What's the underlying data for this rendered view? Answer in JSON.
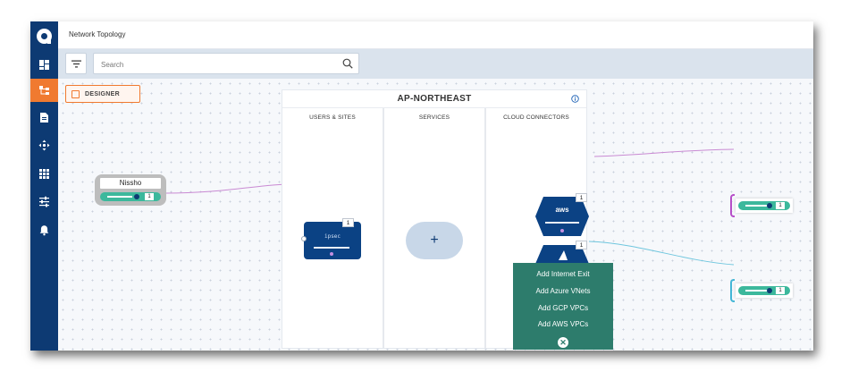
{
  "header": {
    "title": "Network Topology"
  },
  "toolbar": {
    "search_placeholder": "Search"
  },
  "sidebar": {
    "items": [
      {
        "icon": "dashboard-icon"
      },
      {
        "icon": "topology-icon",
        "active": true
      },
      {
        "icon": "document-icon"
      },
      {
        "icon": "move-icon"
      },
      {
        "icon": "apps-grid-icon"
      },
      {
        "icon": "sliders-icon"
      },
      {
        "icon": "bell-icon"
      }
    ]
  },
  "designer": {
    "label": "DESIGNER"
  },
  "region": {
    "title": "AP-NORTHEAST",
    "columns": [
      "USERS & SITES",
      "SERVICES",
      "CLOUD CONNECTORS"
    ]
  },
  "edge": {
    "label": "Nissho",
    "count": "1"
  },
  "site": {
    "logo": "ipsec",
    "badge": "1"
  },
  "services": {
    "add_symbol": "+"
  },
  "cloud": {
    "aws": {
      "label": "aws",
      "badge": "1"
    },
    "azure": {
      "badge": "1"
    }
  },
  "menu": {
    "items": [
      "Add Internet Exit",
      "Add Azure VNets",
      "Add GCP VPCs",
      "Add AWS VPCs"
    ],
    "close_symbol": "✕"
  },
  "connectors": [
    {
      "count": "1",
      "accent": "#b64fc8"
    },
    {
      "count": "1",
      "accent": "#43b6d6"
    }
  ],
  "colors": {
    "sidebar": "#0d3a73",
    "accent": "#f07a30",
    "device": "#3cb89c",
    "menu": "#2d7c6c",
    "pagination": [
      "#b64fc8",
      "#43b6d6"
    ]
  }
}
